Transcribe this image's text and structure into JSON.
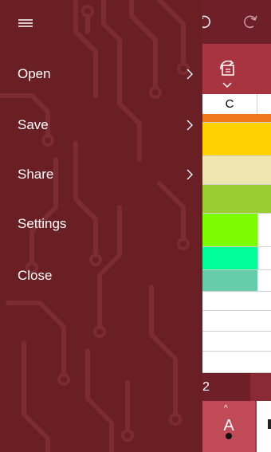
{
  "sheet": {
    "column_label": "C",
    "sheet_tab_label": "2",
    "rows": [
      {
        "color": "#f07a1a"
      },
      {
        "color": "#ffd200"
      },
      {
        "color": "#f0e6b0"
      },
      {
        "color": "#9acd32"
      },
      {
        "color": "#7cfc00"
      },
      {
        "color": "#00ff99"
      },
      {
        "color": "#66cdaa"
      },
      {
        "color": "#ffffff"
      },
      {
        "color": "#ffffff"
      },
      {
        "color": "#ffffff"
      },
      {
        "color": "#ffffff"
      }
    ]
  },
  "font_button": {
    "glyph": "A",
    "up_arrow": "^"
  },
  "drawer": {
    "items": [
      {
        "label": "Open",
        "has_submenu": true
      },
      {
        "label": "Save",
        "has_submenu": true
      },
      {
        "label": "Share",
        "has_submenu": true
      },
      {
        "label": "Settings",
        "has_submenu": false
      },
      {
        "label": "Close",
        "has_submenu": false
      }
    ]
  },
  "colors": {
    "drawer_bg": "#6a1f24",
    "toolbar": "#a8343f",
    "topbar": "#6f1f28"
  },
  "icons": [
    "hamburger-icon",
    "undo-icon",
    "redo-icon",
    "chevron-right-icon",
    "format-icon",
    "font-color-icon"
  ]
}
